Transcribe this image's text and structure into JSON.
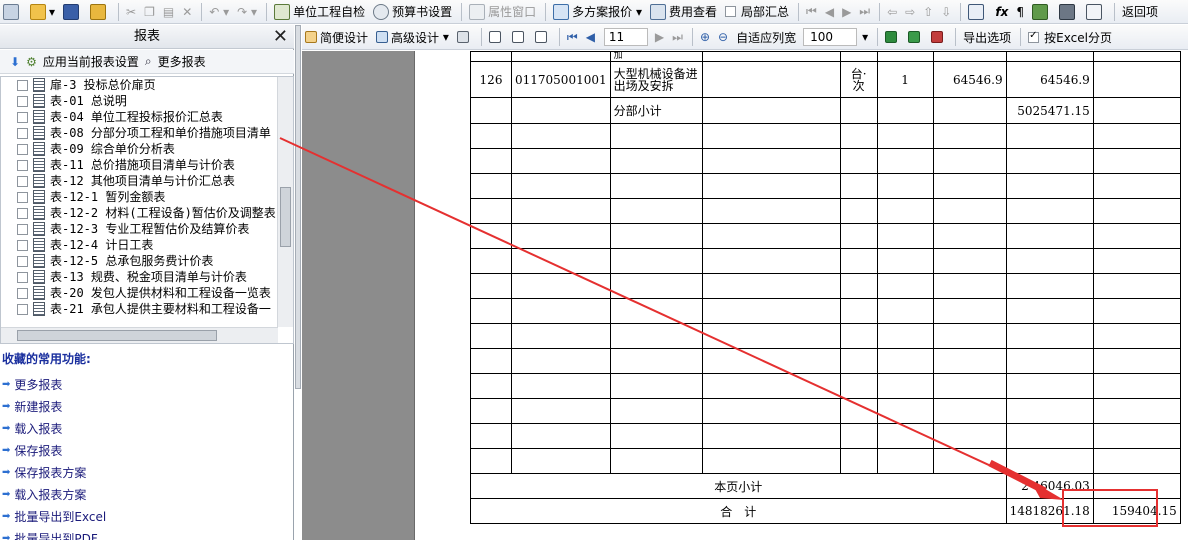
{
  "toolbar1": {
    "self_check": "单位工程自检",
    "budget_settings": "预算书设置",
    "property_window": "属性窗口",
    "multi_plan_quote": "多方案报价",
    "fee_view": "费用查看",
    "partial_summary": "局部汇总",
    "back": "返回项"
  },
  "left_pane": {
    "title": "报表",
    "apply_settings": "应用当前报表设置",
    "more_reports": "更多报表",
    "tree": [
      "扉-3 投标总价扉页",
      "表-01 总说明",
      "表-04 单位工程投标报价汇总表",
      "表-08 分部分项工程和单价措施项目清单",
      "表-09 综合单价分析表",
      "表-11 总价措施项目清单与计价表",
      "表-12 其他项目清单与计价汇总表",
      "表-12-1 暂列金额表",
      "表-12-2 材料(工程设备)暂估价及调整表",
      "表-12-3 专业工程暂估价及结算价表",
      "表-12-4 计日工表",
      "表-12-5 总承包服务费计价表",
      "表-13 规费、税金项目清单与计价表",
      "表-20 发包人提供材料和工程设备一览表",
      "表-21 承包人提供主要材料和工程设备一"
    ],
    "favorites_title": "收藏的常用功能:",
    "favorites": [
      "更多报表",
      "新建报表",
      "载入报表",
      "保存报表",
      "保存报表方案",
      "载入报表方案",
      "批量导出到Excel",
      "批量导出到PDF"
    ]
  },
  "toolbar2": {
    "simple_design": "简便设计",
    "advanced_design": "高级设计",
    "page_number": "11",
    "fit_columns": "自适应列宽",
    "zoom": "100",
    "export_options": "导出选项",
    "excel_paging": "按Excel分页"
  },
  "report": {
    "top_fragment": "加",
    "row": {
      "index": "126",
      "code": "011705001001",
      "name_line1": "大型机械设备进",
      "name_line2": "出场及安拆",
      "unit_line1": "台·",
      "unit_line2": "次",
      "quantity": "1",
      "unit_price": "64546.9",
      "total": "64546.9"
    },
    "subtotal_label": "分部小计",
    "subtotal_value": "5025471.15",
    "page_subtotal_label": "本页小计",
    "page_subtotal_value": "2 46046.03",
    "grand_total_label": "合　计",
    "grand_total_value": "14818261.18",
    "highlight_value": "159404.15"
  }
}
